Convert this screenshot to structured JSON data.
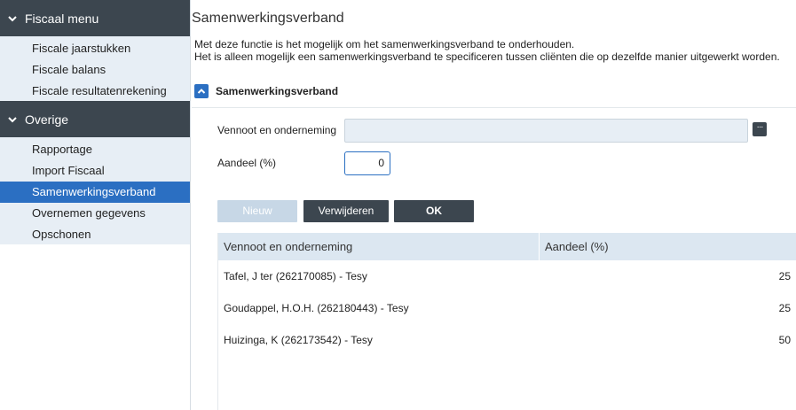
{
  "sidebar": {
    "groups": [
      {
        "title": "Fiscaal menu",
        "items": [
          "Fiscale jaarstukken",
          "Fiscale balans",
          "Fiscale resultatenrekening"
        ]
      },
      {
        "title": "Overige",
        "items": [
          "Rapportage",
          "Import Fiscaal",
          "Samenwerkingsverband",
          "Overnemen gegevens",
          "Opschonen"
        ]
      }
    ],
    "active_item": "Samenwerkingsverband"
  },
  "main": {
    "title": "Samenwerkingsverband",
    "description_line1": "Met deze functie is het mogelijk om het samenwerkingsverband te onderhouden.",
    "description_line2": "Het is alleen mogelijk een samenwerkingsverband te specificeren tussen cliënten die op dezelfde manier uitgewerkt worden.",
    "section_title": "Samenwerkingsverband",
    "form": {
      "partner_label": "Vennoot en onderneming",
      "partner_value": "",
      "share_label": "Aandeel (%)",
      "share_value": "0",
      "more_label": "···"
    },
    "buttons": {
      "new": "Nieuw",
      "delete": "Verwijderen",
      "ok": "OK"
    },
    "table": {
      "headers": [
        "Vennoot en onderneming",
        "Aandeel (%)"
      ],
      "rows": [
        {
          "partner": "Tafel, J ter (262170085) - Tesy",
          "share": "25"
        },
        {
          "partner": "Goudappel, H.O.H. (262180443) - Tesy",
          "share": "25"
        },
        {
          "partner": "Huizinga, K (262173542) - Tesy",
          "share": "50"
        }
      ]
    }
  },
  "colors": {
    "sidebar_header": "#3c464f",
    "sidebar_body": "#e7eef5",
    "accent": "#2b6fc2",
    "button_dark": "#3c464f",
    "button_disabled": "#c7d7e6",
    "table_header": "#dce7f1"
  }
}
